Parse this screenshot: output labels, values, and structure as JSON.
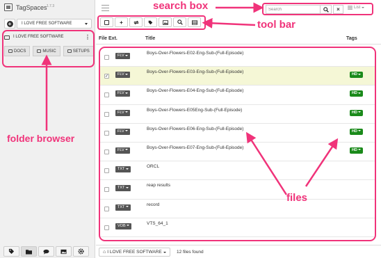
{
  "app": {
    "name": "TagSpaces",
    "version": "1.7.3"
  },
  "location": {
    "current": "I LOVE FREE SOFTWARE"
  },
  "folder": {
    "title": "I LOVE FREE SOFTWARE",
    "subfolders": [
      "DOCS",
      "MUSIC",
      "SETUPS"
    ]
  },
  "search": {
    "placeholder": "Search",
    "clear_label": "×"
  },
  "view": {
    "mode": "List"
  },
  "table": {
    "columns": [
      "File Ext.",
      "Title",
      "Tags"
    ],
    "rows": [
      {
        "ext": "FLV",
        "title": "Boys-Over-Flowers-E02-Eng-Sub-(Full-Episode)",
        "tag": "",
        "checked": false
      },
      {
        "ext": "FLV",
        "title": "Boys-Over-Flowers-E03-Eng-Sub-(Full-Episode)",
        "tag": "HD",
        "checked": true
      },
      {
        "ext": "FLV",
        "title": "Boys-Over-Flowers-E04-Eng-Sub-(Full-Episode)",
        "tag": "HD",
        "checked": false
      },
      {
        "ext": "FLV",
        "title": "Boys-Over-Flowers-E05Eng-Sub-(Full-Episode)",
        "tag": "HD",
        "checked": false
      },
      {
        "ext": "FLV",
        "title": "Boys-Over-Flowers-E06-Eng-Sub-(Full-Episode)",
        "tag": "HD",
        "checked": false
      },
      {
        "ext": "FLV",
        "title": "Boys-Over-Flowers-E07-Eng-Sub-(Full-Episode)",
        "tag": "HD",
        "checked": false
      },
      {
        "ext": "TXT",
        "title": "ORCL",
        "tag": "",
        "checked": false
      },
      {
        "ext": "TXT",
        "title": "reap results",
        "tag": "",
        "checked": false
      },
      {
        "ext": "TXT",
        "title": "record",
        "tag": "",
        "checked": false
      },
      {
        "ext": "VOB",
        "title": "VTS_64_1",
        "tag": "",
        "checked": false
      }
    ]
  },
  "status": {
    "location": "I LOVE FREE SOFTWARE",
    "count": "12 files found"
  },
  "toolbar_icons": [
    "checkbox-icon",
    "plus-icon",
    "refresh-icon",
    "tag-icon",
    "image-icon",
    "zoom-icon",
    "table-icon"
  ],
  "bottom_tools": [
    "tag-icon",
    "folder-icon",
    "chat-icon",
    "image-icon",
    "gear-icon"
  ],
  "annotations": {
    "search_box": "search box",
    "tool_bar": "tool bar",
    "folder_browser": "folder browser",
    "files": "files"
  },
  "colors": {
    "annotation": "#f0337a",
    "tag_green": "#1a8a1a",
    "selected_row": "#f5f7d6"
  }
}
